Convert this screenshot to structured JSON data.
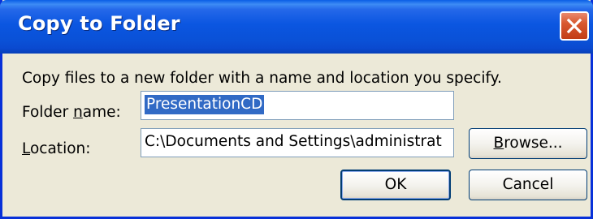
{
  "window": {
    "title": "Copy to Folder",
    "close_icon": "close-icon"
  },
  "description": "Copy files to a new folder with a name and location you specify.",
  "folder_name": {
    "label_before": "Folder ",
    "label_accesskey": "n",
    "label_after": "ame:",
    "value": "PresentationCD"
  },
  "location": {
    "label_accesskey": "L",
    "label_after": "ocation:",
    "value": "C:\\Documents and Settings\\administrat"
  },
  "buttons": {
    "browse_accesskey": "B",
    "browse_rest": "rowse...",
    "ok": "OK",
    "cancel": "Cancel"
  },
  "colors": {
    "titlebar": "#0a51d7",
    "close_button": "#d8582f",
    "dialog_face": "#ece9d8",
    "selection": "#316ac5"
  }
}
